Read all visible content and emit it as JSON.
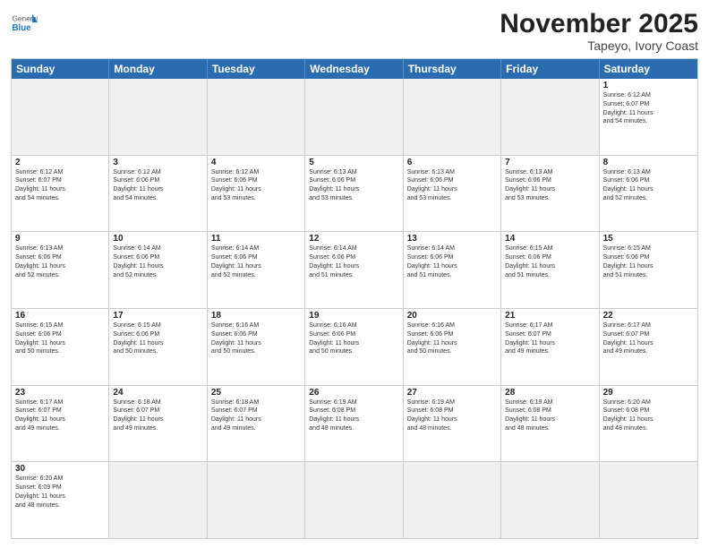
{
  "header": {
    "logo_general": "General",
    "logo_blue": "Blue",
    "month_title": "November 2025",
    "location": "Tapeyo, Ivory Coast"
  },
  "day_headers": [
    "Sunday",
    "Monday",
    "Tuesday",
    "Wednesday",
    "Thursday",
    "Friday",
    "Saturday"
  ],
  "weeks": [
    {
      "days": [
        {
          "number": "",
          "info": "",
          "empty": true
        },
        {
          "number": "",
          "info": "",
          "empty": true
        },
        {
          "number": "",
          "info": "",
          "empty": true
        },
        {
          "number": "",
          "info": "",
          "empty": true
        },
        {
          "number": "",
          "info": "",
          "empty": true
        },
        {
          "number": "",
          "info": "",
          "empty": true
        },
        {
          "number": "1",
          "info": "Sunrise: 6:12 AM\nSunset: 6:07 PM\nDaylight: 11 hours\nand 54 minutes.",
          "empty": false
        }
      ]
    },
    {
      "days": [
        {
          "number": "2",
          "info": "Sunrise: 6:12 AM\nSunset: 6:07 PM\nDaylight: 11 hours\nand 54 minutes.",
          "empty": false
        },
        {
          "number": "3",
          "info": "Sunrise: 6:12 AM\nSunset: 6:06 PM\nDaylight: 11 hours\nand 54 minutes.",
          "empty": false
        },
        {
          "number": "4",
          "info": "Sunrise: 6:12 AM\nSunset: 6:06 PM\nDaylight: 11 hours\nand 53 minutes.",
          "empty": false
        },
        {
          "number": "5",
          "info": "Sunrise: 6:13 AM\nSunset: 6:06 PM\nDaylight: 11 hours\nand 53 minutes.",
          "empty": false
        },
        {
          "number": "6",
          "info": "Sunrise: 6:13 AM\nSunset: 6:06 PM\nDaylight: 11 hours\nand 53 minutes.",
          "empty": false
        },
        {
          "number": "7",
          "info": "Sunrise: 6:13 AM\nSunset: 6:06 PM\nDaylight: 11 hours\nand 53 minutes.",
          "empty": false
        },
        {
          "number": "8",
          "info": "Sunrise: 6:13 AM\nSunset: 6:06 PM\nDaylight: 11 hours\nand 52 minutes.",
          "empty": false
        }
      ]
    },
    {
      "days": [
        {
          "number": "9",
          "info": "Sunrise: 6:13 AM\nSunset: 6:06 PM\nDaylight: 11 hours\nand 52 minutes.",
          "empty": false
        },
        {
          "number": "10",
          "info": "Sunrise: 6:14 AM\nSunset: 6:06 PM\nDaylight: 11 hours\nand 52 minutes.",
          "empty": false
        },
        {
          "number": "11",
          "info": "Sunrise: 6:14 AM\nSunset: 6:06 PM\nDaylight: 11 hours\nand 52 minutes.",
          "empty": false
        },
        {
          "number": "12",
          "info": "Sunrise: 6:14 AM\nSunset: 6:06 PM\nDaylight: 11 hours\nand 51 minutes.",
          "empty": false
        },
        {
          "number": "13",
          "info": "Sunrise: 6:14 AM\nSunset: 6:06 PM\nDaylight: 11 hours\nand 51 minutes.",
          "empty": false
        },
        {
          "number": "14",
          "info": "Sunrise: 6:15 AM\nSunset: 6:06 PM\nDaylight: 11 hours\nand 51 minutes.",
          "empty": false
        },
        {
          "number": "15",
          "info": "Sunrise: 6:15 AM\nSunset: 6:06 PM\nDaylight: 11 hours\nand 51 minutes.",
          "empty": false
        }
      ]
    },
    {
      "days": [
        {
          "number": "16",
          "info": "Sunrise: 6:15 AM\nSunset: 6:06 PM\nDaylight: 11 hours\nand 50 minutes.",
          "empty": false
        },
        {
          "number": "17",
          "info": "Sunrise: 6:15 AM\nSunset: 6:06 PM\nDaylight: 11 hours\nand 50 minutes.",
          "empty": false
        },
        {
          "number": "18",
          "info": "Sunrise: 6:16 AM\nSunset: 6:06 PM\nDaylight: 11 hours\nand 50 minutes.",
          "empty": false
        },
        {
          "number": "19",
          "info": "Sunrise: 6:16 AM\nSunset: 6:06 PM\nDaylight: 11 hours\nand 50 minutes.",
          "empty": false
        },
        {
          "number": "20",
          "info": "Sunrise: 6:16 AM\nSunset: 6:06 PM\nDaylight: 11 hours\nand 50 minutes.",
          "empty": false
        },
        {
          "number": "21",
          "info": "Sunrise: 6:17 AM\nSunset: 6:07 PM\nDaylight: 11 hours\nand 49 minutes.",
          "empty": false
        },
        {
          "number": "22",
          "info": "Sunrise: 6:17 AM\nSunset: 6:07 PM\nDaylight: 11 hours\nand 49 minutes.",
          "empty": false
        }
      ]
    },
    {
      "days": [
        {
          "number": "23",
          "info": "Sunrise: 6:17 AM\nSunset: 6:07 PM\nDaylight: 11 hours\nand 49 minutes.",
          "empty": false
        },
        {
          "number": "24",
          "info": "Sunrise: 6:18 AM\nSunset: 6:07 PM\nDaylight: 11 hours\nand 49 minutes.",
          "empty": false
        },
        {
          "number": "25",
          "info": "Sunrise: 6:18 AM\nSunset: 6:07 PM\nDaylight: 11 hours\nand 49 minutes.",
          "empty": false
        },
        {
          "number": "26",
          "info": "Sunrise: 6:19 AM\nSunset: 6:08 PM\nDaylight: 11 hours\nand 48 minutes.",
          "empty": false
        },
        {
          "number": "27",
          "info": "Sunrise: 6:19 AM\nSunset: 6:08 PM\nDaylight: 11 hours\nand 48 minutes.",
          "empty": false
        },
        {
          "number": "28",
          "info": "Sunrise: 6:19 AM\nSunset: 6:08 PM\nDaylight: 11 hours\nand 48 minutes.",
          "empty": false
        },
        {
          "number": "29",
          "info": "Sunrise: 6:20 AM\nSunset: 6:08 PM\nDaylight: 11 hours\nand 48 minutes.",
          "empty": false
        }
      ]
    },
    {
      "days": [
        {
          "number": "30",
          "info": "Sunrise: 6:20 AM\nSunset: 6:09 PM\nDaylight: 11 hours\nand 48 minutes.",
          "empty": false
        },
        {
          "number": "",
          "info": "",
          "empty": true
        },
        {
          "number": "",
          "info": "",
          "empty": true
        },
        {
          "number": "",
          "info": "",
          "empty": true
        },
        {
          "number": "",
          "info": "",
          "empty": true
        },
        {
          "number": "",
          "info": "",
          "empty": true
        },
        {
          "number": "",
          "info": "",
          "empty": true
        }
      ]
    }
  ]
}
